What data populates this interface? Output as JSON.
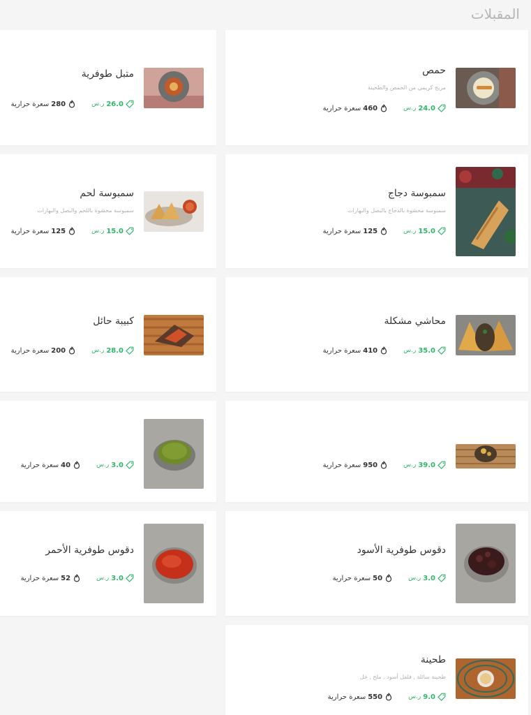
{
  "header": {
    "title": "المقبلات"
  },
  "colors": {
    "price": "#2fb86b",
    "text": "#333333",
    "muted": "#b0b0b0"
  },
  "icons": {
    "price": "tag-icon",
    "calories": "flame-icon"
  },
  "items": [
    {
      "name": "حمص",
      "desc": "مزيج كريمي من الحمص والطحينة",
      "price": "24.0",
      "currency": "ر.س",
      "calories": "460",
      "cal_label": "سعرة حرارية"
    },
    {
      "name": "متبل طوفرية",
      "desc": "",
      "price": "26.0",
      "currency": "ر.س",
      "calories": "280",
      "cal_label": "سعرة حرارية"
    },
    {
      "name": "سمبوسة دجاج",
      "desc": "سمبوسة محشوة بالدجاج بالبصل والبهارات",
      "price": "15.0",
      "currency": "ر.س",
      "calories": "125",
      "cal_label": "سعرة حرارية"
    },
    {
      "name": "سمبوسة لحم",
      "desc": "سمبوسة محشوة باللحم والبصل والبهارات",
      "price": "15.0",
      "currency": "ر.س",
      "calories": "125",
      "cal_label": "سعرة حرارية"
    },
    {
      "name": "محاشي مشكلة",
      "desc": "",
      "price": "35.0",
      "currency": "ر.س",
      "calories": "410",
      "cal_label": "سعرة حرارية"
    },
    {
      "name": "كبيبة حائل",
      "desc": "",
      "price": "28.0",
      "currency": "ر.س",
      "calories": "200",
      "cal_label": "سعرة حرارية"
    },
    {
      "name": "",
      "desc": "",
      "price": "39.0",
      "currency": "ر.س",
      "calories": "950",
      "cal_label": "سعرة حرارية"
    },
    {
      "name": "",
      "desc": "",
      "price": "3.0",
      "currency": "ر.س",
      "calories": "40",
      "cal_label": "سعرة حرارية"
    },
    {
      "name": "دقوس طوفرية الأسود",
      "desc": "",
      "price": "3.0",
      "currency": "ر.س",
      "calories": "50",
      "cal_label": "سعرة حرارية"
    },
    {
      "name": "دقوس طوفرية الأحمر",
      "desc": "",
      "price": "3.0",
      "currency": "ر.س",
      "calories": "52",
      "cal_label": "سعرة حرارية"
    },
    {
      "name": "طحينة",
      "desc": "طحينة سائلة , فلفل أسود , ملح , خل",
      "price": "9.0",
      "currency": "ر.س",
      "calories": "550",
      "cal_label": "سعرة حرارية"
    }
  ]
}
